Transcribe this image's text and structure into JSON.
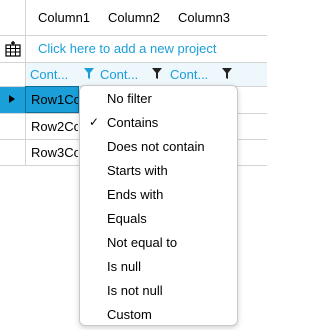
{
  "grid": {
    "columns": [
      "Column1",
      "Column2",
      "Column3"
    ],
    "new_row_text": "Click here to add a new project",
    "filter_cells": [
      "Cont...",
      "Cont...",
      "Cont..."
    ],
    "rows": [
      "Row1Col...",
      "Row2Col...",
      "Row3Col..."
    ],
    "accent": "#1a9fd9"
  },
  "filter_menu": {
    "items": [
      {
        "label": "No filter",
        "checked": false
      },
      {
        "label": "Contains",
        "checked": true
      },
      {
        "label": "Does not contain",
        "checked": false
      },
      {
        "label": "Starts with",
        "checked": false
      },
      {
        "label": "Ends with",
        "checked": false
      },
      {
        "label": "Equals",
        "checked": false
      },
      {
        "label": "Not equal to",
        "checked": false
      },
      {
        "label": "Is null",
        "checked": false
      },
      {
        "label": "Is not null",
        "checked": false
      },
      {
        "label": "Custom",
        "checked": false
      }
    ],
    "check_glyph": "✓"
  }
}
